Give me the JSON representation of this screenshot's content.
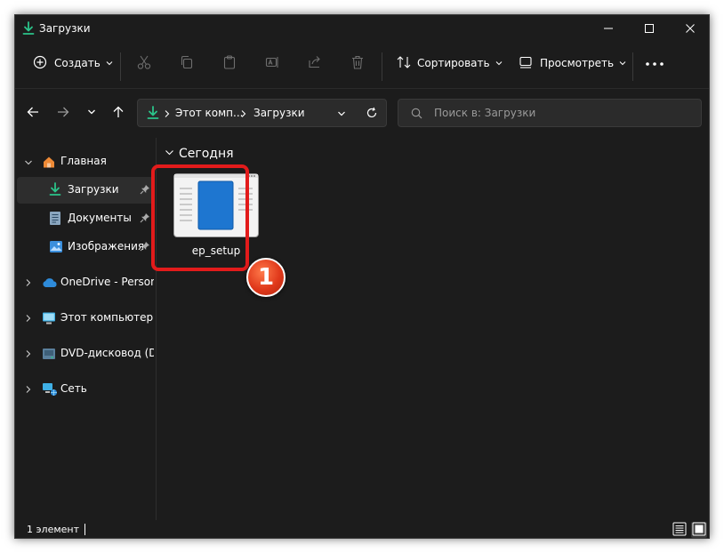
{
  "window": {
    "title": "Загрузки",
    "controls": {
      "minimize": "minimize",
      "maximize": "maximize",
      "close": "close"
    }
  },
  "toolbar": {
    "create_label": "Создать",
    "sort_label": "Сортировать",
    "view_label": "Просмотреть",
    "icons": [
      "cut-icon",
      "copy-icon",
      "paste-icon",
      "rename-icon",
      "share-icon",
      "delete-icon",
      "more-icon"
    ]
  },
  "address": {
    "parts": [
      "Этот комп...",
      "Загрузки"
    ]
  },
  "search": {
    "placeholder": "Поиск в: Загрузки"
  },
  "sidebar": {
    "items": [
      {
        "label": "Главная",
        "icon": "home-icon"
      },
      {
        "label": "Загрузки",
        "icon": "download-icon",
        "pinned": true,
        "selected": true
      },
      {
        "label": "Документы",
        "icon": "documents-icon",
        "pinned": true
      },
      {
        "label": "Изображения",
        "icon": "pictures-icon",
        "pinned": true
      },
      {
        "label": "OneDrive - Personal",
        "icon": "onedrive-icon"
      },
      {
        "label": "Этот компьютер",
        "icon": "computer-icon"
      },
      {
        "label": "DVD-дисковод (D:) C",
        "icon": "dvd-icon"
      },
      {
        "label": "Сеть",
        "icon": "network-icon"
      }
    ]
  },
  "content": {
    "group_header": "Сегодня",
    "files": [
      {
        "name": "ep_setup",
        "icon": "installer-file-icon"
      }
    ]
  },
  "annotation": {
    "badge_number": "1",
    "color": "#e21b1b"
  },
  "status": {
    "text": "1 элемент"
  },
  "colors": {
    "accent": "#2e8bda",
    "download_green": "#2bc48a",
    "background": "#1c1c1c"
  }
}
